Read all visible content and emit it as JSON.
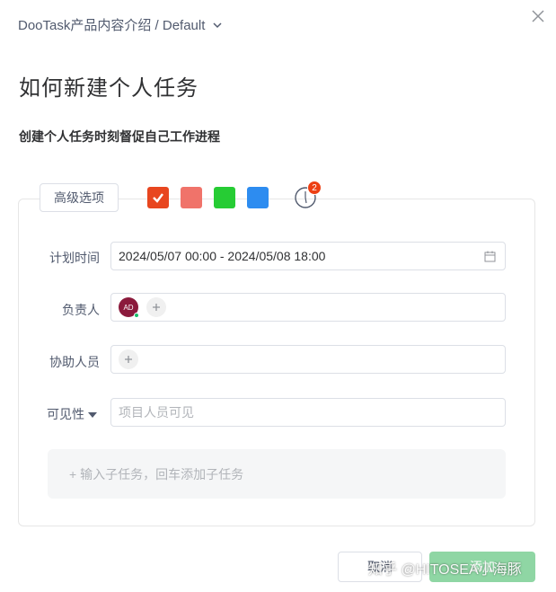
{
  "header": {
    "breadcrumb": "DooTask产品内容介绍 / Default"
  },
  "task": {
    "title": "如何新建个人任务",
    "description": "创建个人任务时刻督促自己工作进程"
  },
  "toolbar": {
    "advanced_label": "高级选项",
    "colors": [
      "#e8461f",
      "#f0736a",
      "#26cc34",
      "#2d8cf0"
    ],
    "selected_color_index": 0,
    "timer_badge": "2"
  },
  "form": {
    "plan_time_label": "计划时间",
    "plan_time_value": "2024/05/07 00:00 - 2024/05/08 18:00",
    "owner_label": "负责人",
    "owner_avatar": "AD",
    "assist_label": "协助人员",
    "visibility_label": "可见性",
    "visibility_placeholder": "项目人员可见"
  },
  "subtask": {
    "placeholder": "+ 输入子任务，回车添加子任务"
  },
  "footer": {
    "cancel_label": "取消",
    "submit_label": "添加",
    "watermark": "知乎 @HITOSEA小海豚"
  }
}
